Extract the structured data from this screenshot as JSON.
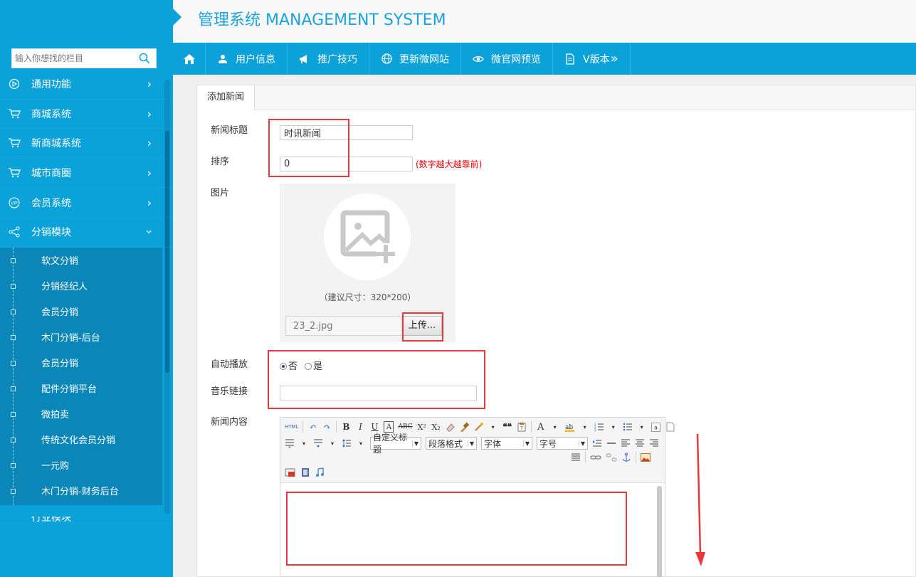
{
  "header": {
    "title": "管理系统 MANAGEMENT SYSTEM"
  },
  "sidebar": {
    "search_placeholder": "输入你想找的栏目",
    "items": [
      {
        "label": "通用功能",
        "icon": "play-circle-icon"
      },
      {
        "label": "商城系统",
        "icon": "cart-icon"
      },
      {
        "label": "新商城系统",
        "icon": "cart-icon"
      },
      {
        "label": "城市商圈",
        "icon": "cart-icon"
      },
      {
        "label": "会员系统",
        "icon": "vip-icon"
      },
      {
        "label": "分销模块",
        "icon": "share-icon",
        "expanded": true
      }
    ],
    "subitems": [
      "软文分销",
      "分销经纪人",
      "会员分销",
      "木门分销-后台",
      "会员分销",
      "配件分销平台",
      "微拍卖",
      "传统文化会员分销",
      "一元购",
      "木门分销-财务后台"
    ],
    "partial_item": "行业模块"
  },
  "topnav": {
    "items": [
      {
        "label": "用户信息",
        "icon": "user-icon"
      },
      {
        "label": "推广技巧",
        "icon": "megaphone-icon"
      },
      {
        "label": "更新微网站",
        "icon": "globe-icon"
      },
      {
        "label": "微官网预览",
        "icon": "eye-icon"
      },
      {
        "label": "V版本",
        "icon": "document-icon"
      }
    ]
  },
  "form": {
    "tab": "添加新闻",
    "title_label": "新闻标题",
    "title_value": "时讯新闻",
    "sort_label": "排序",
    "sort_value": "0",
    "sort_hint": "(数字越大越靠前)",
    "image_label": "图片",
    "image_hint": "（建议尺寸：320*200）",
    "image_filename": "23_2.jpg",
    "upload_button": "上传...",
    "autoplay_label": "自动播放",
    "autoplay_no": "否",
    "autoplay_yes": "是",
    "autoplay_selected": "否",
    "music_label": "音乐链接",
    "music_value": "",
    "content_label": "新闻内容"
  },
  "editor": {
    "custom_title": "自定义标题",
    "paragraph": "段落格式",
    "font": "字体",
    "size": "字号",
    "tools_row1": [
      "HTML",
      "↶",
      "↷",
      "B",
      "I",
      "U",
      "A",
      "ABC",
      "X²",
      "X₂",
      "❝❝"
    ]
  },
  "colors": {
    "sidebar": "#0ba1d9",
    "accent": "#1aa3dc",
    "highlight": "#e8383d"
  }
}
